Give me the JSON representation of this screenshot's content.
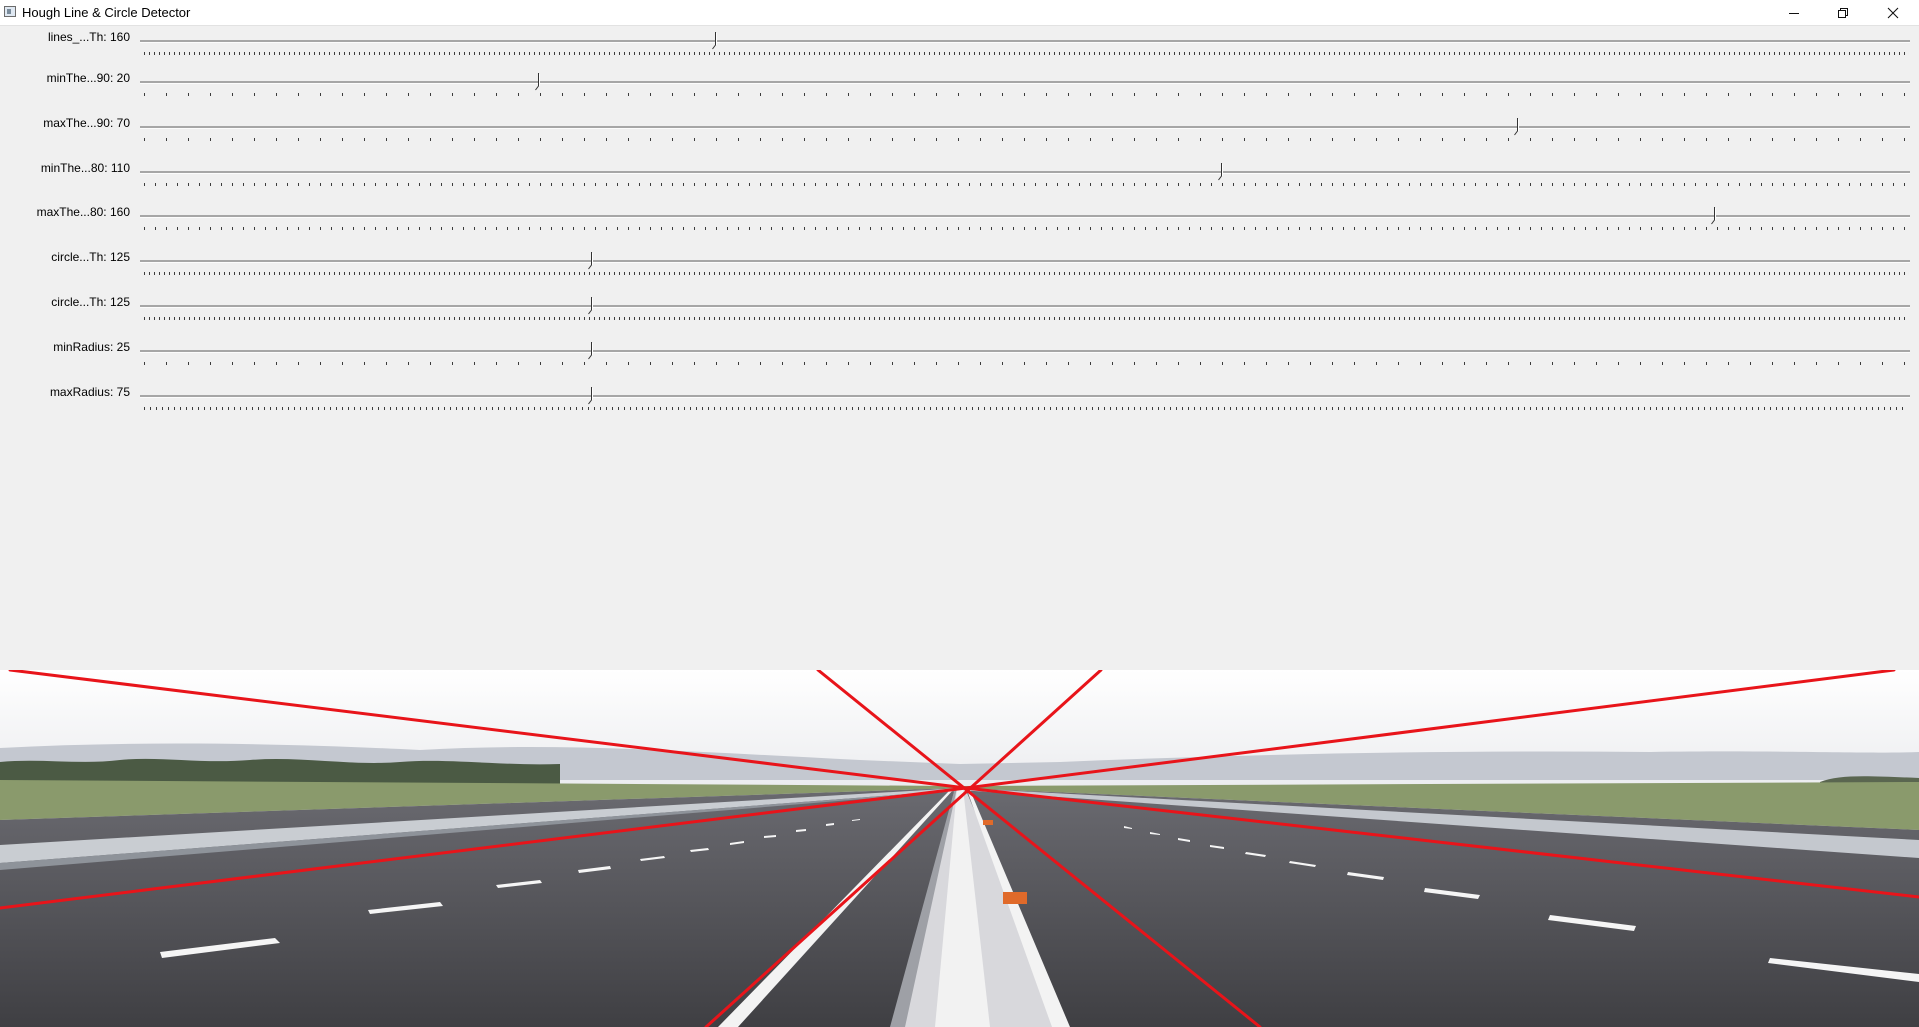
{
  "window": {
    "title": "Hough Line & Circle Detector"
  },
  "trackbars": [
    {
      "label": "lines_...Th",
      "value": "160",
      "fraction": 0.325,
      "tick_step": 5
    },
    {
      "label": "minThe...90",
      "value": "20",
      "fraction": 0.225,
      "tick_step": 22
    },
    {
      "label": "maxThe...90",
      "value": "70",
      "fraction": 0.778,
      "tick_step": 22
    },
    {
      "label": "minThe...80",
      "value": "110",
      "fraction": 0.611,
      "tick_step": 11
    },
    {
      "label": "maxThe...80",
      "value": "160",
      "fraction": 0.889,
      "tick_step": 11
    },
    {
      "label": "circle...Th",
      "value": "125",
      "fraction": 0.255,
      "tick_step": 5
    },
    {
      "label": "circle...Th",
      "value": "125",
      "fraction": 0.255,
      "tick_step": 5
    },
    {
      "label": "minRadius",
      "value": "25",
      "fraction": 0.255,
      "tick_step": 22
    },
    {
      "label": "maxRadius",
      "value": "75",
      "fraction": 0.255,
      "tick_step": 6
    }
  ],
  "image": {
    "description_icons": [
      "road-scene-icon"
    ],
    "line_color": "#e8141a"
  },
  "colors": {
    "background": "#f0f0f0",
    "titlebar": "#ffffff",
    "sky": "#f6f6f7",
    "road": "#4c4c50"
  }
}
